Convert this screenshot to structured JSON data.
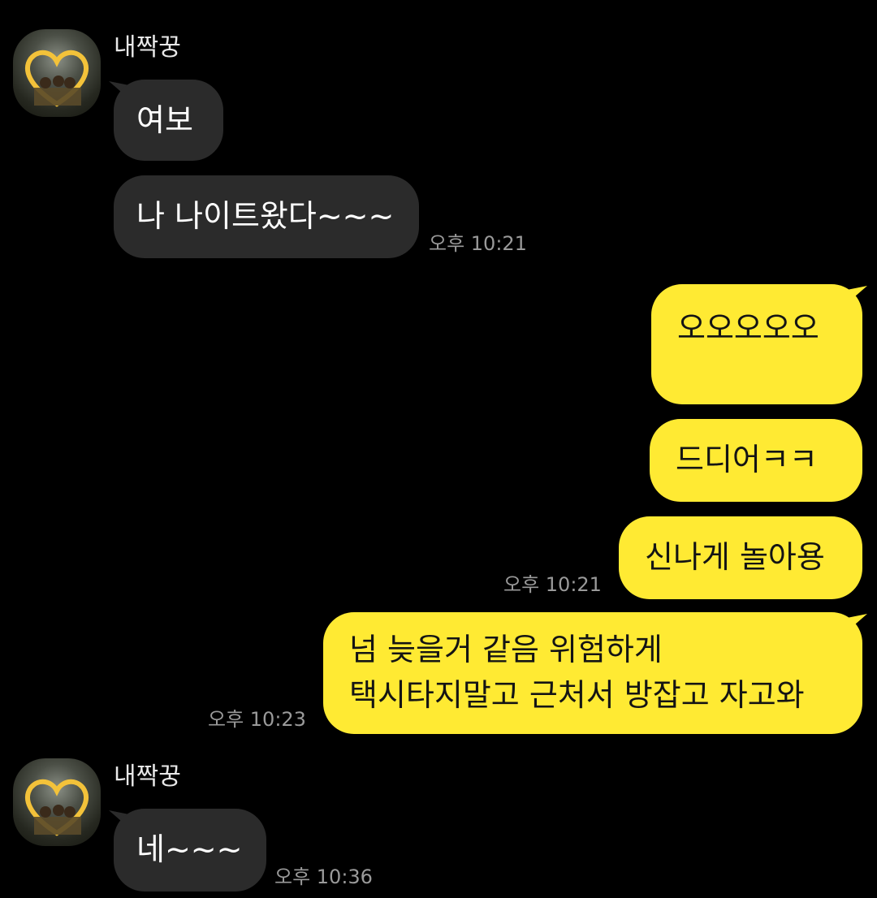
{
  "chat": {
    "sender_name": "내짝꿍",
    "messages": [
      {
        "from": "them",
        "text": "여보"
      },
      {
        "from": "them",
        "text": "나 나이트왔다~~~",
        "time": "오후 10:21"
      },
      {
        "from": "me",
        "text": "오오오오오"
      },
      {
        "from": "me",
        "text": "드디어ㅋㅋ"
      },
      {
        "from": "me",
        "text": "신나게 놀아용",
        "time": "오후 10:21"
      },
      {
        "from": "me",
        "text_line1": "넘 늦을거 같음 위험하게",
        "text_line2": "택시타지말고 근처서 방잡고 자고와",
        "time": "오후 10:23"
      },
      {
        "from": "them",
        "text": "네~~~",
        "time": "오후 10:36"
      }
    ]
  },
  "colors": {
    "background": "#000000",
    "incoming_bubble": "#2b2b2b",
    "outgoing_bubble": "#ffea33",
    "time_text": "#9a9a9a"
  }
}
